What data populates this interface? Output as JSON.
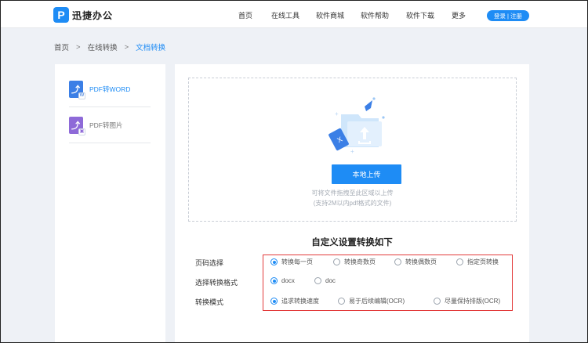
{
  "header": {
    "logo_mark": "P",
    "logo_text": "迅捷办公",
    "nav": [
      "首页",
      "在线工具",
      "软件商城",
      "软件帮助",
      "软件下载",
      "更多"
    ],
    "login_label": "登录 | 注册"
  },
  "breadcrumb": {
    "items": [
      "首页",
      "在线转换",
      "文档转换"
    ],
    "separator": ">"
  },
  "sidebar": {
    "items": [
      {
        "label": "PDF转WORD",
        "icon": "pdf-to-word-icon",
        "color": "#3b7fe6",
        "badge": "W",
        "active": true
      },
      {
        "label": "PDF转图片",
        "icon": "pdf-to-image-icon",
        "color": "#8e6ad8",
        "badge": "▣",
        "active": false
      }
    ]
  },
  "upload": {
    "button_label": "本地上传",
    "hint_line1": "可将文件拖拽至此区域以上传",
    "hint_line2": "(支持2M以内pdf格式的文件)"
  },
  "settings": {
    "title": "自定义设置转换如下",
    "rows": [
      {
        "label": "页码选择",
        "options": [
          "转换每一页",
          "转换奇数页",
          "转换偶数页",
          "指定页转换"
        ],
        "selected": 0
      },
      {
        "label": "选择转换格式",
        "options": [
          "docx",
          "doc"
        ],
        "selected": 0
      },
      {
        "label": "转换模式",
        "options": [
          "追求转换速度",
          "易于后续编辑(OCR)",
          "尽量保持排版(OCR)"
        ],
        "selected": 0
      }
    ]
  },
  "colors": {
    "accent": "#1e8cf5",
    "highlight_border": "#e23a3a"
  }
}
